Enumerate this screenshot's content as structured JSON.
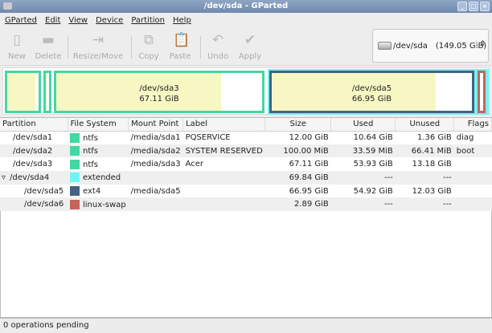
{
  "window": {
    "title": "/dev/sda - GParted"
  },
  "menu": [
    "GParted",
    "Edit",
    "View",
    "Device",
    "Partition",
    "Help"
  ],
  "toolbar": [
    {
      "label": "New",
      "icon": "new-icon"
    },
    {
      "label": "Delete",
      "icon": "delete-icon"
    },
    {
      "label": "Resize/Move",
      "icon": "resize-icon"
    },
    {
      "label": "Copy",
      "icon": "copy-icon"
    },
    {
      "label": "Paste",
      "icon": "paste-icon"
    },
    {
      "label": "Undo",
      "icon": "undo-icon"
    },
    {
      "label": "Apply",
      "icon": "apply-icon"
    }
  ],
  "device": {
    "name": "/dev/sda",
    "size": "(149.05 GiB)"
  },
  "graph": {
    "sda3": {
      "name": "/dev/sda3",
      "size": "67.11 GiB",
      "used_fraction": 0.8
    },
    "sda5": {
      "name": "/dev/sda5",
      "size": "66.95 GiB",
      "used_fraction": 0.82
    },
    "sda1_used_fraction": 0.89,
    "sda2_used_fraction": 0.34
  },
  "columns": [
    "Partition",
    "File System",
    "Mount Point",
    "Label",
    "Size",
    "Used",
    "Unused",
    "Flags"
  ],
  "rows": [
    {
      "partition": "/dev/sda1",
      "fs": "ntfs",
      "color": "#43d7a2",
      "mount": "/media/sda1",
      "label": "PQSERVICE",
      "size": "12.00 GiB",
      "used": "10.64 GiB",
      "unused": "1.36 GiB",
      "flags": "diag",
      "indent": 1
    },
    {
      "partition": "/dev/sda2",
      "fs": "ntfs",
      "color": "#43d7a2",
      "mount": "/media/sda2",
      "label": "SYSTEM RESERVED",
      "size": "100.00 MiB",
      "used": "33.59 MiB",
      "unused": "66.41 MiB",
      "flags": "boot",
      "indent": 1
    },
    {
      "partition": "/dev/sda3",
      "fs": "ntfs",
      "color": "#43d7a2",
      "mount": "/media/sda3",
      "label": "Acer",
      "size": "67.11 GiB",
      "used": "53.93 GiB",
      "unused": "13.18 GiB",
      "flags": "",
      "indent": 1
    },
    {
      "partition": "/dev/sda4",
      "fs": "extended",
      "color": "#74f3f4",
      "mount": "",
      "label": "",
      "size": "69.84 GiB",
      "used": "---",
      "unused": "---",
      "flags": "",
      "indent": 0,
      "expander": "▿"
    },
    {
      "partition": "/dev/sda5",
      "fs": "ext4",
      "color": "#46617f",
      "mount": "/media/sda5",
      "label": "",
      "size": "66.95 GiB",
      "used": "54.92 GiB",
      "unused": "12.03 GiB",
      "flags": "",
      "indent": 2
    },
    {
      "partition": "/dev/sda6",
      "fs": "linux-swap",
      "color": "#c4655a",
      "mount": "",
      "label": "",
      "size": "2.89 GiB",
      "used": "---",
      "unused": "---",
      "flags": "",
      "indent": 2
    }
  ],
  "status": "0 operations pending"
}
